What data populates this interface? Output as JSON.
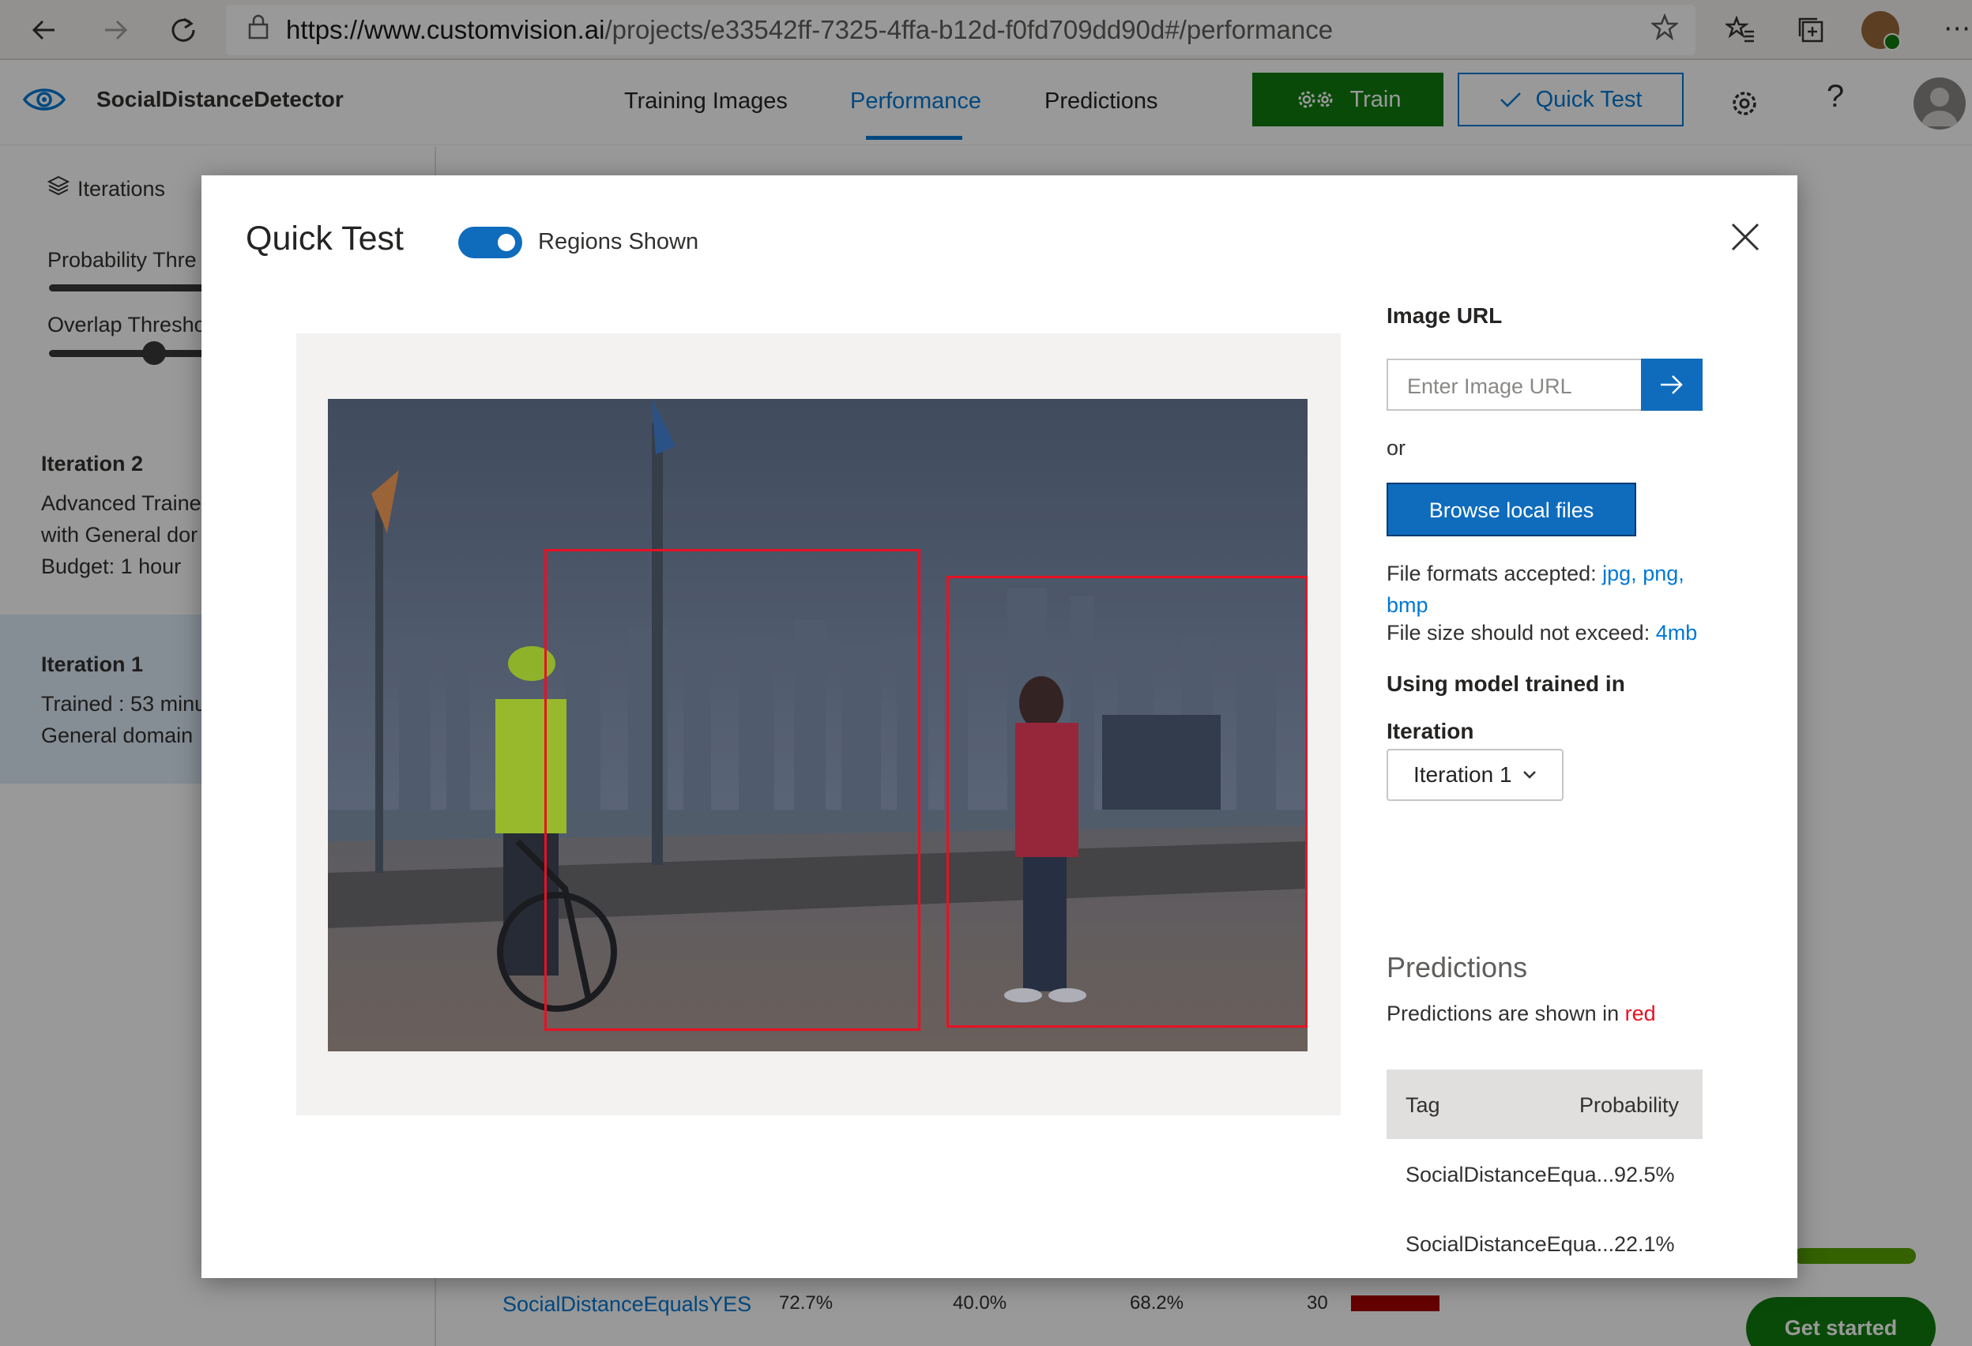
{
  "browser": {
    "url_host": "https://www.customvision.ai",
    "url_path": "/projects/e33542ff-7325-4ffa-b12d-f0fd709dd90d#/performance"
  },
  "header": {
    "project_name": "SocialDistanceDetector",
    "tabs": [
      {
        "label": "Training Images"
      },
      {
        "label": "Performance"
      },
      {
        "label": "Predictions"
      }
    ],
    "train_label": "Train",
    "quick_test_label": "Quick Test",
    "help_label": "?"
  },
  "sidebar": {
    "iterations_label": "Iterations",
    "probability_label": "Probability Thre",
    "overlap_label": "Overlap Thresho",
    "iteration2": {
      "title": "Iteration 2",
      "line1": "Advanced Traine",
      "line2": "with General dor",
      "line3": "Budget: 1 hour"
    },
    "iteration1": {
      "title": "Iteration 1",
      "line1": "Trained : 53 minu",
      "line2": "General domain"
    }
  },
  "background_table": {
    "tag": "SocialDistanceEqualsYES",
    "precision": "72.7%",
    "recall": "40.0%",
    "ap": "68.2%",
    "count": "30"
  },
  "get_started_label": "Get started",
  "modal": {
    "title": "Quick Test",
    "toggle_label": "Regions Shown",
    "toggle_on": true,
    "image_url_label": "Image URL",
    "image_url_placeholder": "Enter Image URL",
    "or_label": "or",
    "browse_label": "Browse local files",
    "formats_prefix": "File formats accepted:",
    "formats_jpg": "jpg,",
    "formats_png": "png,",
    "formats_bmp": "bmp",
    "size_prefix": "File size should not exceed:",
    "size_value": "4mb",
    "model_label": "Using model trained in",
    "iteration_label": "Iteration",
    "iteration_selected": "Iteration 1",
    "predictions_heading": "Predictions",
    "predictions_note_prefix": "Predictions are shown in",
    "predictions_note_color": "red",
    "table_headers": {
      "tag": "Tag",
      "probability": "Probability"
    },
    "rows": [
      {
        "tag": "SocialDistanceEqua...",
        "probability": "92.5%"
      },
      {
        "tag": "SocialDistanceEqua...",
        "probability": "22.1%"
      }
    ]
  },
  "colors": {
    "accent": "#0078d4",
    "train_green": "#107c10",
    "region_red": "#e81123"
  }
}
